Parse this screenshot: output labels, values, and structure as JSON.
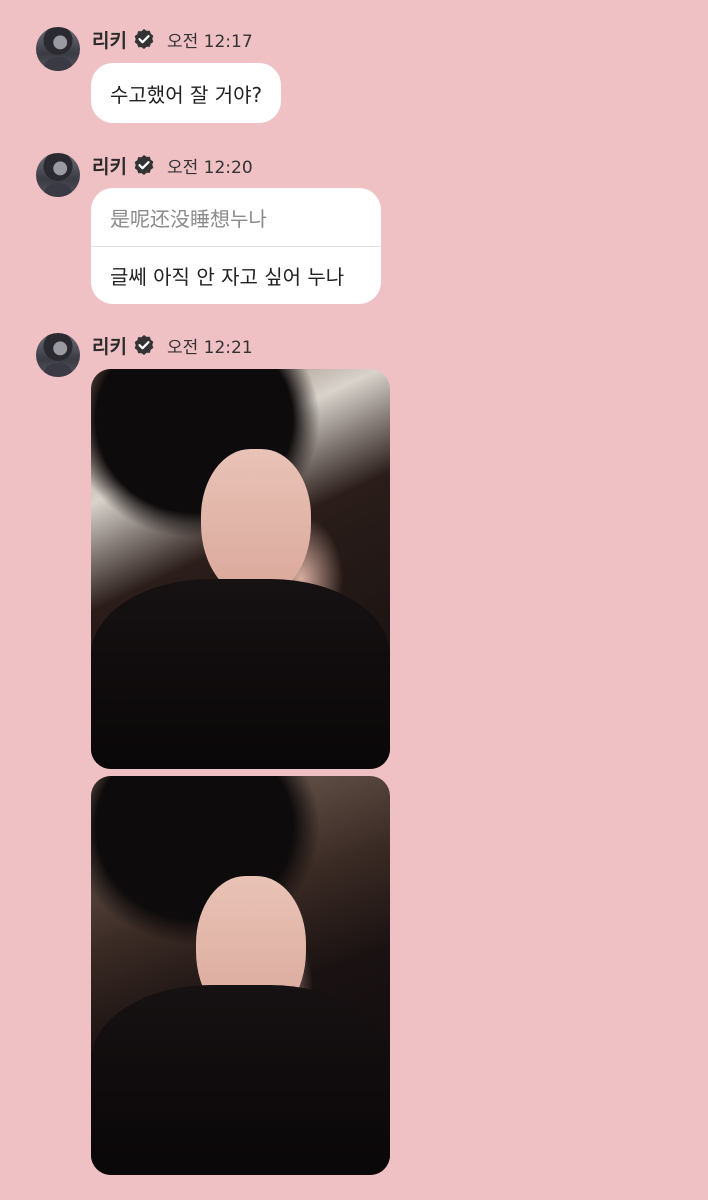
{
  "messages": [
    {
      "sender": "리키",
      "time": "오전 12:17",
      "text": "수고했어 잘 거야?"
    },
    {
      "sender": "리키",
      "time": "오전 12:20",
      "original": "是呢还没睡想누나",
      "translation": "글쎄 아직 안 자고 싶어 누나"
    },
    {
      "sender": "리키",
      "time": "오전 12:21",
      "photos": [
        "selfie-photo-1",
        "selfie-photo-2"
      ]
    }
  ],
  "icons": {
    "verified": "verified-check-icon"
  },
  "colors": {
    "background": "#efc1c4",
    "bubble": "#ffffff",
    "translation_text": "#8a8a8a"
  }
}
